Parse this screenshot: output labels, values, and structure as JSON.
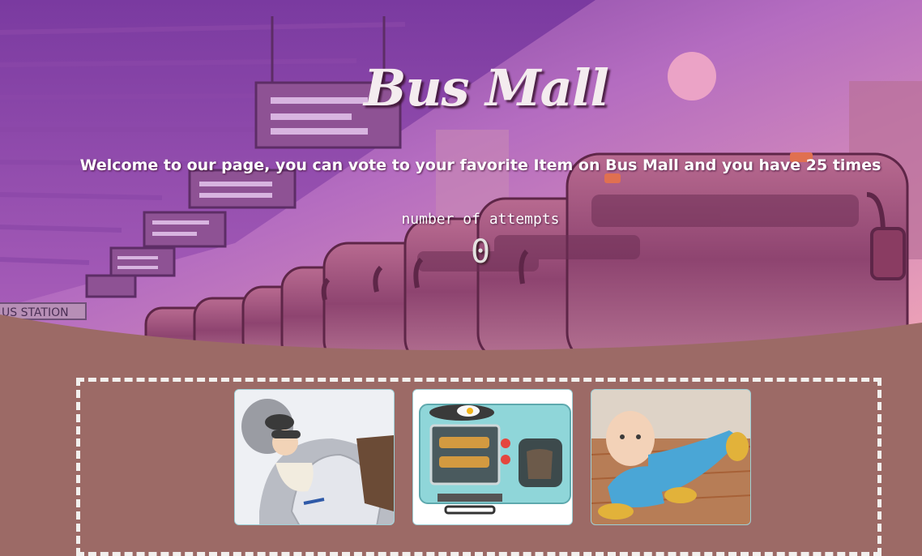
{
  "header": {
    "title": "Bus Mall",
    "welcome": "Welcome to our page, you can vote to your favorite Item on Bus Mall and you have 25 times",
    "attempts_label": "number of attempts",
    "attempts_count": "0",
    "station_sign": "US STATION"
  },
  "products": [
    {
      "icon": "tauntaun-sleeping-bag-image"
    },
    {
      "icon": "breakfast-station-image"
    },
    {
      "icon": "baby-sweeper-image"
    }
  ],
  "colors": {
    "page_background": "#9c6a66",
    "hero_top": "#7b3a9a",
    "hero_bottom": "#e39ab8",
    "dashed_border": "#f2f0ee"
  }
}
